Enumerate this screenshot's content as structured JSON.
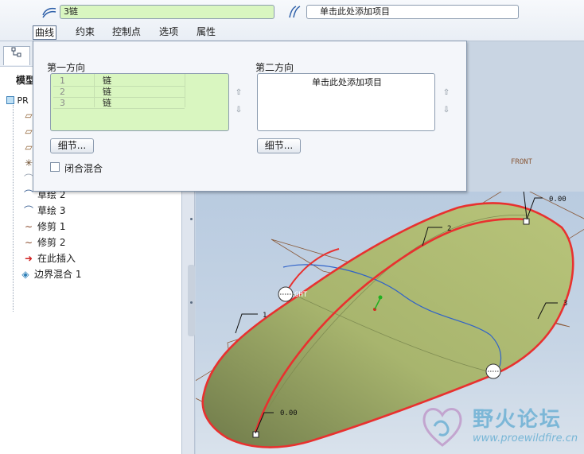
{
  "dashboard": {
    "first_collector_value": "3链",
    "second_collector_value": "单击此处添加项目",
    "tabs": [
      {
        "label": "曲线",
        "active": true
      },
      {
        "label": "约束",
        "active": false
      },
      {
        "label": "控制点",
        "active": false
      },
      {
        "label": "选项",
        "active": false
      },
      {
        "label": "属性",
        "active": false
      }
    ]
  },
  "curves_panel": {
    "first_direction_label": "第一方向",
    "second_direction_label": "第二方向",
    "first_list": [
      {
        "index": "1",
        "value": "链"
      },
      {
        "index": "2",
        "value": "链"
      },
      {
        "index": "3",
        "value": "链"
      }
    ],
    "second_list_placeholder": "单击此处添加项目",
    "details_button_label": "细节...",
    "second_details_button_label": "细节...",
    "closed_blend_label": "闭合混合",
    "closed_blend_checked": false
  },
  "model_tree": {
    "heading": "模型",
    "root_label": "PR",
    "items": [
      {
        "label": "",
        "icon": "datum-plane-icon"
      },
      {
        "label": "",
        "icon": "datum-plane-icon"
      },
      {
        "label": "",
        "icon": "datum-plane-icon"
      },
      {
        "label": "",
        "icon": "csys-icon"
      },
      {
        "label": "",
        "icon": "sketch-icon"
      },
      {
        "label": "草绘 2",
        "icon": "sketch-icon"
      },
      {
        "label": "草绘 3",
        "icon": "sketch-icon"
      },
      {
        "label": "修剪 1",
        "icon": "trim-curve-icon"
      },
      {
        "label": "修剪 2",
        "icon": "trim-curve-icon"
      },
      {
        "label": "在此插入",
        "icon": "insert-arrow-icon"
      },
      {
        "label": "边界混合 1",
        "icon": "boundary-blend-icon"
      }
    ]
  },
  "graphics_labels": {
    "front_plane": "FRONT",
    "right_plane": "GHT",
    "dim_top": "0.00",
    "dim_bottom": "0.00",
    "curve_1": "1",
    "curve_2": "2",
    "curve_3": "3"
  },
  "watermark": {
    "text": "野火论坛",
    "url": "www.proewildfire.cn"
  },
  "colors": {
    "surface": "#a8b66a",
    "boundary": "#e8312f",
    "sketch": "#3a6fd1",
    "datum": "#8a5a3a"
  }
}
